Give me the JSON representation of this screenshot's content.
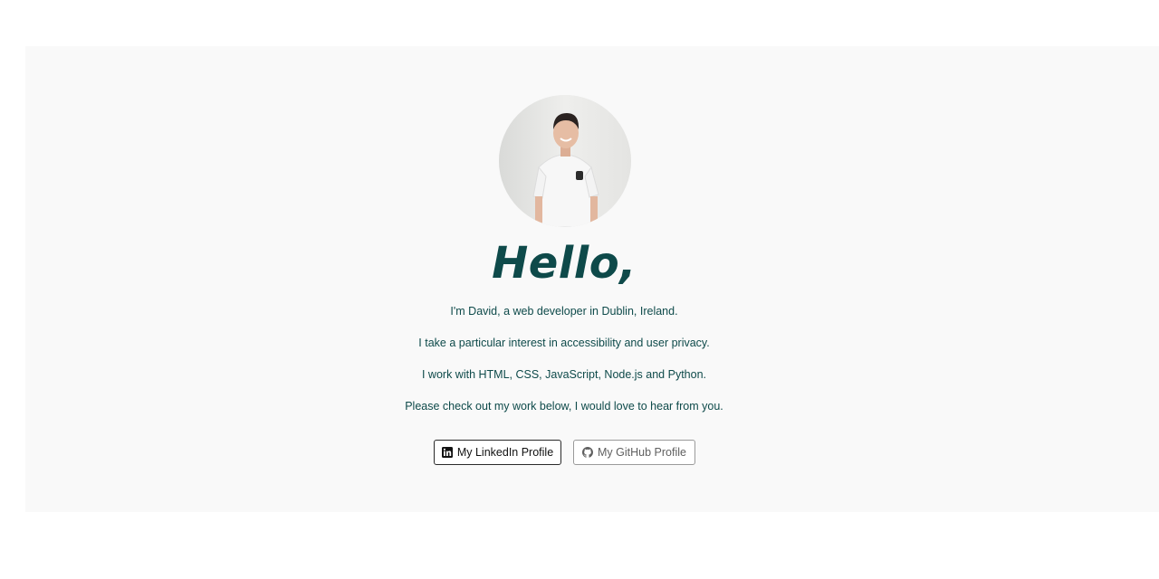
{
  "hero": {
    "avatar_alt": "Portrait of David",
    "title": "Hello,",
    "paragraphs": [
      "I'm David, a web developer in Dublin, Ireland.",
      "I take a particular interest in accessibility and user privacy.",
      "I work with HTML, CSS, JavaScript, Node.js and Python.",
      "Please check out my work below, I would love to hear from you."
    ],
    "buttons": {
      "linkedin_label": "My LinkedIn Profile",
      "github_label": "My GitHub Profile"
    }
  },
  "colors": {
    "heading": "#0e4a4a",
    "hero_background": "#f9f9f9"
  },
  "icons": {
    "linkedin": "linkedin-icon",
    "github": "github-icon"
  }
}
